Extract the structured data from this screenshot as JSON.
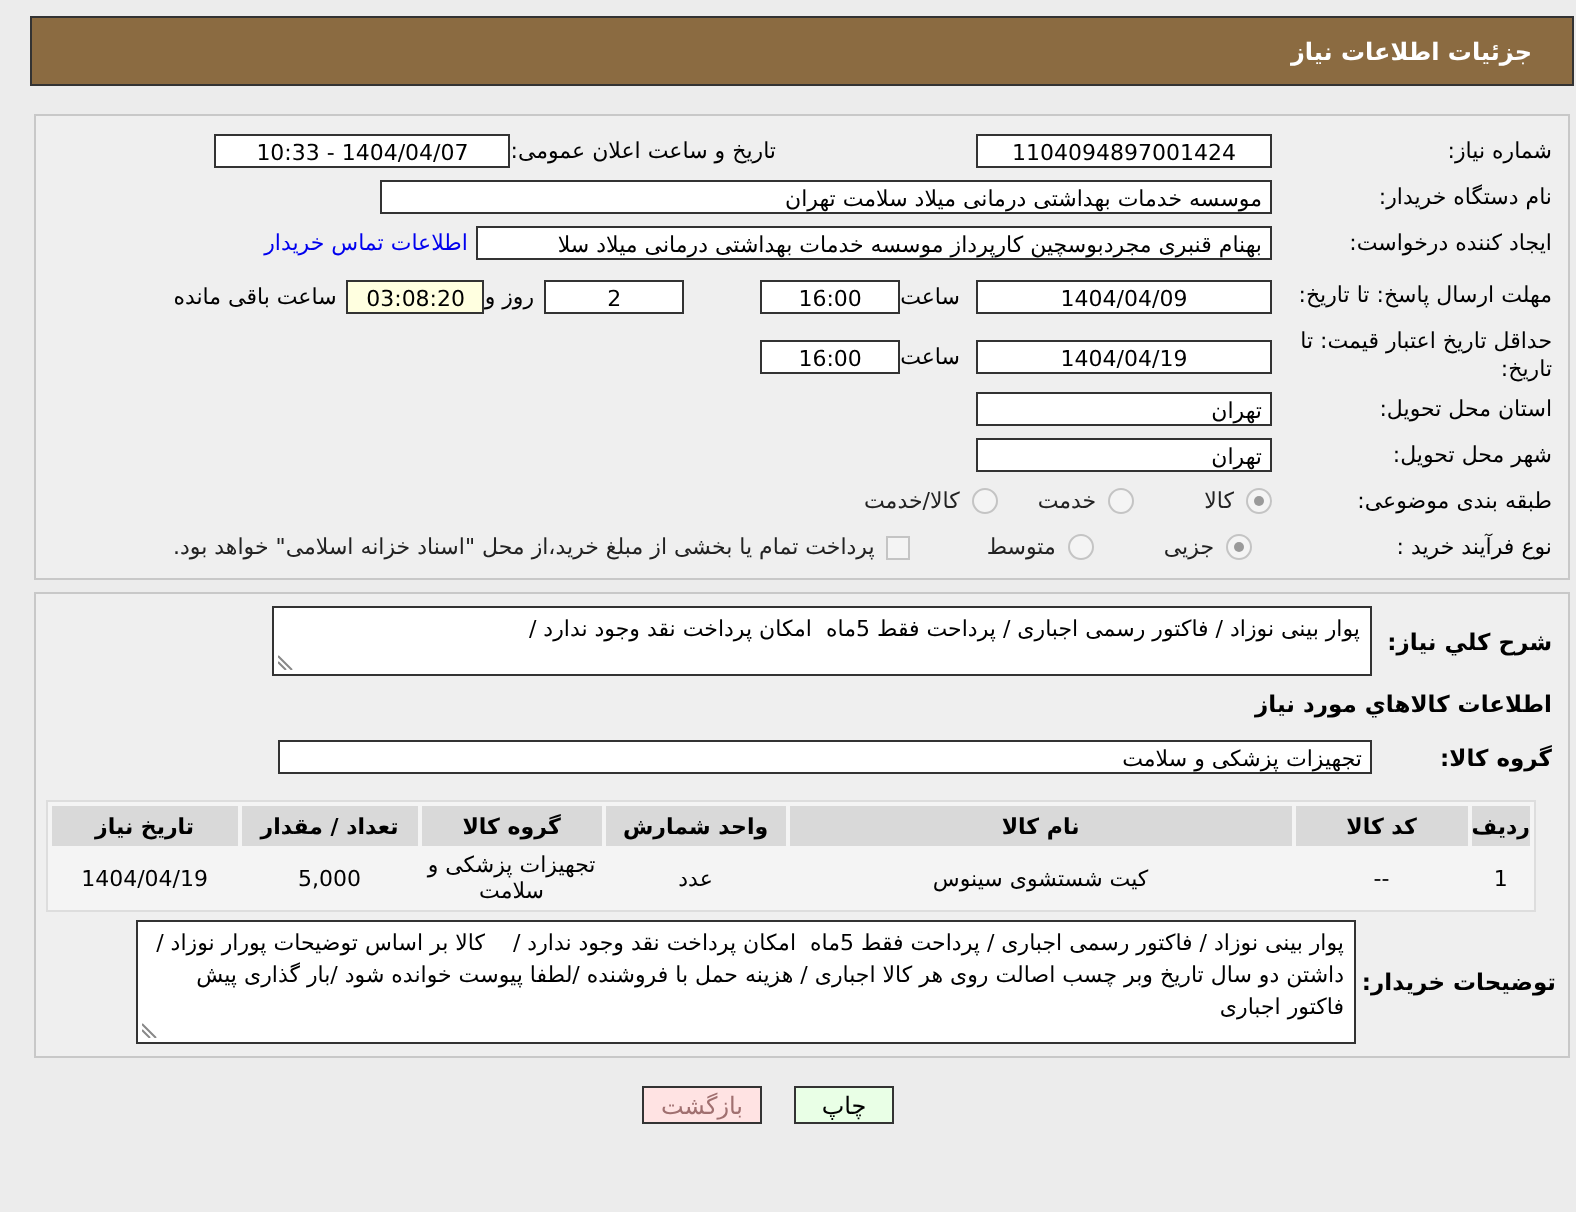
{
  "header": {
    "title": "جزئیات اطلاعات نیاز"
  },
  "details": {
    "need_number": {
      "label": "شماره نیاز:",
      "value": "1104094897001424"
    },
    "announce": {
      "label": "تاریخ و ساعت اعلان عمومی:",
      "value": "1404/04/07 - 10:33"
    },
    "buyer_org": {
      "label": "نام دستگاه خریدار:",
      "value": "موسسه خدمات بهداشتی درمانی میلاد سلامت تهران"
    },
    "requester": {
      "label": "ایجاد کننده درخواست:",
      "value": "بهنام قنبری مجردبوسچین کارپرداز موسسه خدمات بهداشتی درمانی میلاد سلا",
      "link": "اطلاعات تماس خریدار"
    },
    "reply_deadline": {
      "label": "مهلت ارسال پاسخ: تا تاریخ:",
      "date": "1404/04/09",
      "time_label": "ساعت",
      "time": "16:00",
      "days": "2",
      "days_label": "روز و",
      "remaining": "03:08:20",
      "remaining_label": "ساعت باقی مانده"
    },
    "price_validity": {
      "label": "حداقل تاریخ اعتبار قیمت: تا تاریخ:",
      "date": "1404/04/19",
      "time_label": "ساعت",
      "time": "16:00"
    },
    "province": {
      "label": "استان محل تحویل:",
      "value": "تهران"
    },
    "city": {
      "label": "شهر محل تحویل:",
      "value": "تهران"
    },
    "category": {
      "label": "طبقه بندی موضوعی:",
      "options": [
        {
          "label": "کالا",
          "selected": true
        },
        {
          "label": "خدمت",
          "selected": false
        },
        {
          "label": "کالا/خدمت",
          "selected": false
        }
      ]
    },
    "process": {
      "label": "نوع فرآیند خرید :",
      "options": [
        {
          "label": "جزیی",
          "selected": true
        },
        {
          "label": "متوسط",
          "selected": false
        }
      ],
      "payment_note": {
        "checked": false,
        "text": "پرداخت تمام یا بخشی از مبلغ خرید،از محل \"اسناد خزانه اسلامی\" خواهد بود."
      }
    }
  },
  "description": {
    "label": "شرح کلي نياز:",
    "value": "پوار بینی نوزاد / فاکتور رسمی اجباری / پرداحت فقط 5ماه  امکان پرداخت نقد وجود ندارد /"
  },
  "goods": {
    "title": "اطلاعات کالاهاي مورد نياز",
    "group": {
      "label": "گروه کالا:",
      "value": "تجهیزات پزشکی و سلامت"
    },
    "table": {
      "columns": [
        "ردیف",
        "کد کالا",
        "نام کالا",
        "واحد شمارش",
        "گروه کالا",
        "تعداد / مقدار",
        "تاریخ نیاز"
      ],
      "rows": [
        [
          "1",
          "--",
          "کیت شستشوی سینوس",
          "عدد",
          "تجهیزات پزشکی و سلامت",
          "5,000",
          "1404/04/19"
        ]
      ]
    }
  },
  "buyer_notes": {
    "label": "توضیحات خریدار:",
    "value": "پوار بینی نوزاد / فاکتور رسمی اجباری / پرداحت فقط 5ماه  امکان پرداخت نقد وجود ندارد /    کالا بر اساس توضیحات پورار نوزاد /داشتن دو سال تاریخ وبر چسب اصالت روی هر کالا اجباری / هزینه حمل با فروشنده /لطفا پیوست خوانده شود /بار گذاری پیش فاکتور اجباری"
  },
  "buttons": [
    {
      "label": "چاپ",
      "kind": "print"
    },
    {
      "label": "بازگشت",
      "kind": "back"
    }
  ]
}
